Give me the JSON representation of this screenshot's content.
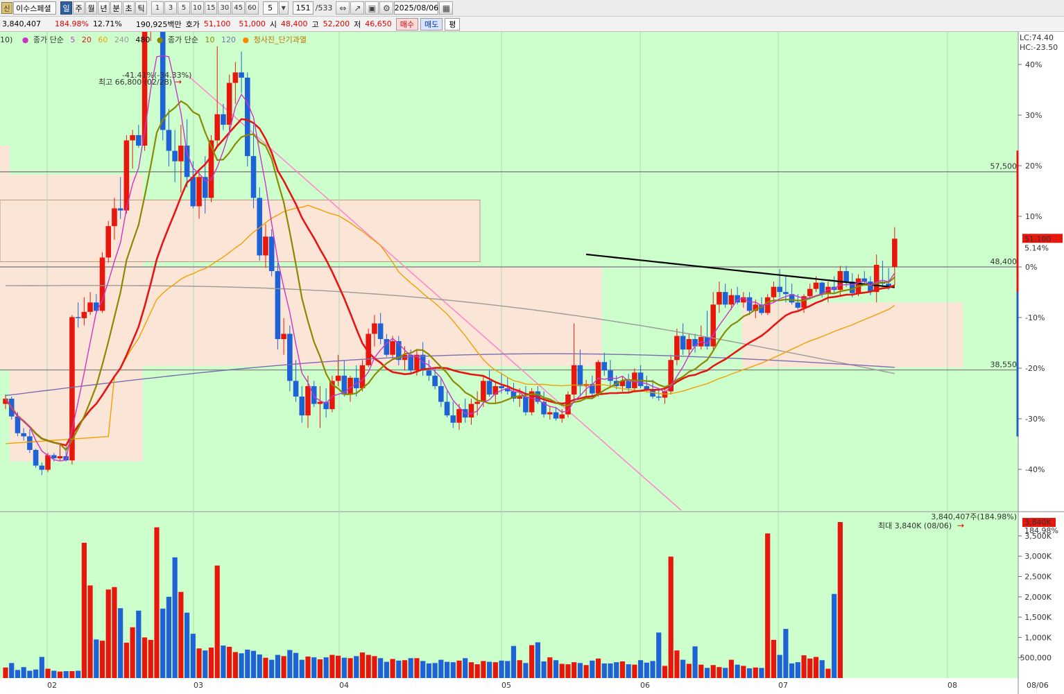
{
  "toolbar": {
    "badge": "신",
    "stock_name": "이수스페셜",
    "periods": [
      "일",
      "주",
      "월",
      "년",
      "분",
      "초",
      "틱"
    ],
    "active_period": "일",
    "intervals": [
      "1",
      "3",
      "5",
      "10",
      "15",
      "30",
      "45",
      "60"
    ],
    "interval_value": "5",
    "count_value": "151",
    "count_total": "/533",
    "date": "2025/08/06"
  },
  "info": {
    "volume": "3,840,407",
    "volume_ratio": "184.98%",
    "turnover": "12.71%",
    "amount": "190,925백만",
    "quote_label": "호가",
    "ask": "51,100",
    "bid": "51,000",
    "open_label": "시",
    "open": "48,400",
    "high_label": "고",
    "high": "52,200",
    "low_label": "저",
    "low": "46,650",
    "buy_btn": "매수",
    "sell_btn": "매도",
    "eval_btn": "평"
  },
  "legend": {
    "prefix": "10)",
    "ma_group1_label": "종가 단순",
    "ma5": "5",
    "ma20": "20",
    "ma60": "60",
    "ma240": "240",
    "ma480": "480",
    "ma_group2_label": "종가 단순",
    "ma10": "10",
    "ma120": "120",
    "signal": "청사진_단기과열"
  },
  "colors": {
    "chart_bg": "#ccffcc",
    "zone": "#fbe5d6",
    "up": "#e8170d",
    "down": "#1f62d6",
    "ma5": "#c835c8",
    "ma10": "#8a8a00",
    "ma20": "#e61414",
    "ma60": "#f0a000",
    "ma120": "#7a6eb0",
    "ma240": "#9a9a9a",
    "ma480": "#000000",
    "trendline": "#ff88cc"
  },
  "annotations": {
    "high_marker": "최고 66,800 (02/28)",
    "high_pct": "-41.41%(-34.33%)",
    "vol_max_marker": "최대 3,840K (08/06)",
    "vol_top": "3,840,407주(184.98%)",
    "lc": "LC:74.40",
    "hc": "HC:-23.50",
    "level_57500": "57,500",
    "level_48400": "48,400",
    "level_38550": "38,550",
    "price_tag": "51,100",
    "price_pct": "5.14%",
    "vol_tag": "3,840K",
    "vol_pct": "184.98%"
  },
  "chart_data": {
    "type": "candlestick",
    "x_labels": [
      "02",
      "03",
      "04",
      "05",
      "06",
      "07",
      "08"
    ],
    "last_date_label": "08/06",
    "pct_ticks": [
      "40%",
      "30%",
      "20%",
      "10%",
      "0%",
      "-10%",
      "-20%",
      "-30%",
      "-40%"
    ],
    "volume_ticks": [
      "3,500K",
      "3,000K",
      "2,500K",
      "2,000K",
      "1,500K",
      "1,000K",
      "500,000"
    ],
    "candles": [
      [
        35300,
        36200,
        34800,
        35800
      ],
      [
        35800,
        36000,
        33800,
        34100
      ],
      [
        34100,
        34500,
        32200,
        32500
      ],
      [
        32500,
        33000,
        31800,
        32200
      ],
      [
        32200,
        32900,
        30600,
        30900
      ],
      [
        30900,
        31000,
        29200,
        29400
      ],
      [
        29400,
        29700,
        28500,
        29000
      ],
      [
        29000,
        30600,
        28800,
        30400
      ],
      [
        30400,
        30600,
        29800,
        30100
      ],
      [
        30100,
        31500,
        29900,
        30300
      ],
      [
        30300,
        31200,
        29800,
        29900
      ],
      [
        29900,
        43800,
        29500,
        43600
      ],
      [
        43600,
        45000,
        42600,
        43500
      ],
      [
        43500,
        45500,
        42800,
        44100
      ],
      [
        44100,
        46000,
        43800,
        45000
      ],
      [
        45000,
        45800,
        43900,
        44200
      ],
      [
        44200,
        49800,
        44000,
        49300
      ],
      [
        49300,
        52800,
        48800,
        52300
      ],
      [
        52300,
        55000,
        51000,
        54000
      ],
      [
        54000,
        57000,
        53000,
        53800
      ],
      [
        53800,
        61000,
        53500,
        60500
      ],
      [
        60500,
        61500,
        57800,
        61000
      ],
      [
        61000,
        62000,
        59800,
        60000
      ],
      [
        60000,
        72000,
        59500,
        71500
      ],
      [
        71500,
        75000,
        70000,
        74000
      ],
      [
        74000,
        77000,
        71500,
        76000
      ],
      [
        77000,
        77800,
        60500,
        61500
      ],
      [
        61500,
        63500,
        58000,
        59500
      ],
      [
        59500,
        61500,
        56500,
        58500
      ],
      [
        58500,
        62000,
        55500,
        60000
      ],
      [
        60000,
        62500,
        56000,
        57000
      ],
      [
        57000,
        58500,
        54000,
        54200
      ],
      [
        54200,
        57500,
        53000,
        57000
      ],
      [
        57000,
        59000,
        53500,
        55000
      ],
      [
        55000,
        61000,
        54600,
        60500
      ],
      [
        60500,
        69500,
        59800,
        63000
      ],
      [
        63000,
        64000,
        61500,
        62000
      ],
      [
        62000,
        66800,
        61000,
        66000
      ],
      [
        66000,
        68000,
        64000,
        67000
      ],
      [
        67000,
        69000,
        65000,
        66500
      ],
      [
        66500,
        67000,
        58000,
        59000
      ],
      [
        59000,
        62000,
        54000,
        55000
      ],
      [
        55000,
        56000,
        49000,
        49500
      ],
      [
        49500,
        52500,
        48300,
        51300
      ],
      [
        51300,
        52000,
        47500,
        48000
      ],
      [
        48000,
        48800,
        40500,
        41500
      ],
      [
        41500,
        43500,
        40000,
        42000
      ],
      [
        42000,
        42800,
        36500,
        37500
      ],
      [
        37500,
        39500,
        35500,
        36000
      ],
      [
        36000,
        37000,
        33500,
        34200
      ],
      [
        34200,
        38000,
        33000,
        37000
      ],
      [
        37000,
        37500,
        35000,
        35300
      ],
      [
        35300,
        37000,
        33000,
        35500
      ],
      [
        35500,
        36800,
        34000,
        34800
      ],
      [
        34800,
        38000,
        34500,
        37500
      ],
      [
        37500,
        40000,
        37000,
        38000
      ],
      [
        38000,
        39500,
        36000,
        36200
      ],
      [
        36200,
        38000,
        35500,
        37800
      ],
      [
        37800,
        39000,
        36000,
        36800
      ],
      [
        36800,
        39500,
        36500,
        39000
      ],
      [
        39000,
        42500,
        38800,
        42000
      ],
      [
        42000,
        43800,
        40800,
        43000
      ],
      [
        43000,
        44000,
        41000,
        41500
      ],
      [
        41500,
        42000,
        39800,
        40000
      ],
      [
        40000,
        41800,
        39500,
        41300
      ],
      [
        41300,
        41800,
        39000,
        39500
      ],
      [
        39500,
        40800,
        38500,
        40000
      ],
      [
        40000,
        40500,
        38200,
        38500
      ],
      [
        38500,
        40500,
        38000,
        40000
      ],
      [
        40000,
        41200,
        38000,
        38500
      ],
      [
        38500,
        39500,
        37500,
        38000
      ],
      [
        38000,
        38800,
        36700,
        37000
      ],
      [
        37000,
        37800,
        35000,
        35500
      ],
      [
        35500,
        36500,
        34000,
        34200
      ],
      [
        34200,
        35500,
        33000,
        33500
      ],
      [
        33500,
        35300,
        32800,
        34800
      ],
      [
        34800,
        35800,
        33500,
        34000
      ],
      [
        34000,
        35800,
        33300,
        35300
      ],
      [
        35300,
        36500,
        34200,
        35500
      ],
      [
        35500,
        38000,
        35000,
        37500
      ],
      [
        37500,
        38500,
        36000,
        36200
      ],
      [
        36200,
        37500,
        35300,
        37000
      ],
      [
        37000,
        38200,
        36300,
        36800
      ],
      [
        36800,
        37800,
        36200,
        36500
      ],
      [
        36500,
        37300,
        35500,
        35800
      ],
      [
        35800,
        36800,
        35000,
        36000
      ],
      [
        36000,
        37000,
        34200,
        34500
      ],
      [
        34500,
        36800,
        34200,
        36500
      ],
      [
        36500,
        37000,
        35300,
        35500
      ],
      [
        35500,
        36500,
        34000,
        34300
      ],
      [
        34300,
        35000,
        33800,
        34500
      ],
      [
        34500,
        35000,
        33700,
        33900
      ],
      [
        33900,
        34800,
        33500,
        34300
      ],
      [
        34300,
        36500,
        34000,
        36200
      ],
      [
        36200,
        43000,
        35800,
        39000
      ],
      [
        39000,
        40500,
        36000,
        37000
      ],
      [
        37000,
        37600,
        35800,
        37200
      ],
      [
        37200,
        38000,
        35800,
        36300
      ],
      [
        36300,
        39500,
        36000,
        39300
      ],
      [
        39300,
        40200,
        38000,
        38500
      ],
      [
        38500,
        39500,
        37000,
        37500
      ],
      [
        37500,
        38000,
        36700,
        37000
      ],
      [
        37000,
        37900,
        36500,
        37500
      ],
      [
        37500,
        38200,
        36300,
        36800
      ],
      [
        36800,
        38700,
        36500,
        38300
      ],
      [
        38300,
        39000,
        36800,
        37000
      ],
      [
        37000,
        38000,
        36500,
        36700
      ],
      [
        36700,
        37600,
        35800,
        36000
      ],
      [
        36000,
        36800,
        35600,
        35900
      ],
      [
        35900,
        36700,
        35300,
        36500
      ],
      [
        36500,
        40000,
        36200,
        39500
      ],
      [
        39500,
        42500,
        39000,
        41800
      ],
      [
        41800,
        43000,
        40000,
        40500
      ],
      [
        40500,
        42000,
        39800,
        41500
      ],
      [
        41500,
        42000,
        40200,
        40800
      ],
      [
        40800,
        42800,
        40500,
        41700
      ],
      [
        41700,
        44200,
        40500,
        40800
      ],
      [
        40800,
        46000,
        40500,
        44800
      ],
      [
        44800,
        47000,
        44000,
        46000
      ],
      [
        46000,
        46800,
        44500,
        44800
      ],
      [
        44800,
        46300,
        44300,
        45700
      ],
      [
        45700,
        46500,
        44800,
        45000
      ],
      [
        45000,
        46000,
        44500,
        45500
      ],
      [
        45500,
        46000,
        43800,
        44200
      ],
      [
        44200,
        45300,
        43500,
        44800
      ],
      [
        44800,
        45500,
        43800,
        44000
      ],
      [
        44000,
        45800,
        43800,
        45500
      ],
      [
        45500,
        47000,
        45000,
        46500
      ],
      [
        46500,
        48200,
        45500,
        46000
      ],
      [
        46000,
        47500,
        45000,
        45800
      ],
      [
        45800,
        46800,
        44800,
        45000
      ],
      [
        45000,
        45800,
        44300,
        44500
      ],
      [
        44500,
        45800,
        44000,
        45600
      ],
      [
        45600,
        46800,
        45300,
        46300
      ],
      [
        46300,
        47500,
        46000,
        46900
      ],
      [
        46900,
        47000,
        45500,
        45800
      ],
      [
        45800,
        47000,
        45000,
        46500
      ],
      [
        46500,
        47500,
        45800,
        46200
      ],
      [
        46200,
        48500,
        45700,
        48000
      ],
      [
        48000,
        48500,
        46500,
        47000
      ],
      [
        47000,
        47800,
        45500,
        45900
      ],
      [
        45900,
        47700,
        45600,
        47300
      ],
      [
        47300,
        48000,
        46700,
        47000
      ],
      [
        47000,
        47500,
        45700,
        46000
      ],
      [
        46000,
        49600,
        45000,
        48600
      ],
      [
        47000,
        49000,
        46500,
        46800
      ],
      [
        46800,
        48300,
        46200,
        46500
      ],
      [
        48400,
        52200,
        46650,
        51100
      ]
    ],
    "volumes": [
      260000,
      370000,
      200000,
      270000,
      180000,
      210000,
      520000,
      230000,
      180000,
      160000,
      170000,
      170000,
      180000,
      3330000,
      2280000,
      950000,
      920000,
      2180000,
      2240000,
      1720000,
      870000,
      1250000,
      1660000,
      1000000,
      940000,
      3710000,
      1710000,
      2000000,
      2970000,
      2120000,
      1610000,
      1090000,
      730000,
      680000,
      750000,
      2770000,
      800000,
      770000,
      640000,
      610000,
      700000,
      670000,
      580000,
      500000,
      450000,
      570000,
      540000,
      690000,
      620000,
      450000,
      530000,
      510000,
      460000,
      510000,
      570000,
      550000,
      500000,
      490000,
      540000,
      630000,
      570000,
      540000,
      490000,
      400000,
      470000,
      430000,
      440000,
      490000,
      490000,
      420000,
      360000,
      370000,
      450000,
      400000,
      390000,
      430000,
      490000,
      390000,
      340000,
      420000,
      400000,
      390000,
      430000,
      420000,
      790000,
      440000,
      370000,
      810000,
      880000,
      410000,
      510000,
      440000,
      350000,
      340000,
      390000,
      370000,
      320000,
      430000,
      480000,
      360000,
      360000,
      390000,
      410000,
      340000,
      330000,
      440000,
      380000,
      420000,
      1120000,
      300000,
      2990000,
      680000,
      450000,
      350000,
      780000,
      330000,
      250000,
      320000,
      270000,
      250000,
      450000,
      330000,
      300000,
      240000,
      260000,
      250000,
      3560000,
      940000,
      570000,
      1210000,
      360000,
      390000,
      560000,
      480000,
      520000,
      440000,
      230000,
      2070000,
      3840000
    ]
  }
}
